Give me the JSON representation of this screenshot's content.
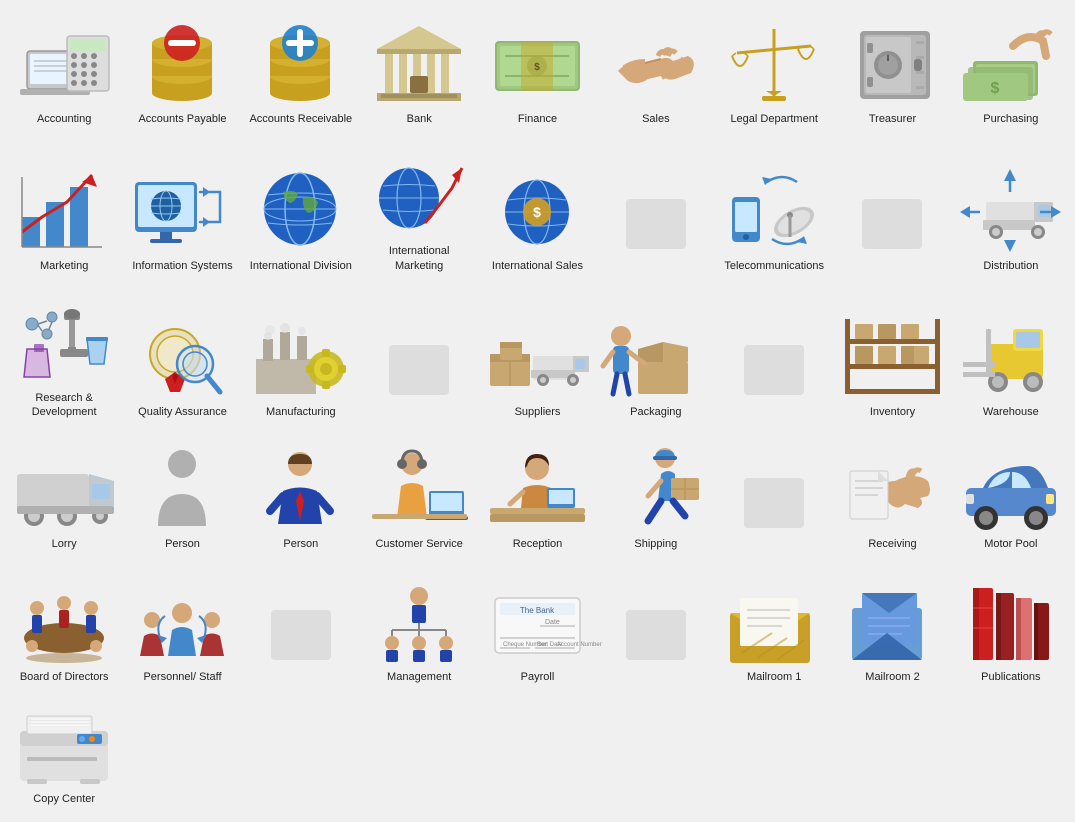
{
  "items": [
    {
      "id": "accounting",
      "label": "Accounting",
      "row": 1
    },
    {
      "id": "accounts-payable",
      "label": "Accounts Payable",
      "row": 1
    },
    {
      "id": "accounts-receivable",
      "label": "Accounts Receivable",
      "row": 1
    },
    {
      "id": "bank",
      "label": "Bank",
      "row": 1
    },
    {
      "id": "finance",
      "label": "Finance",
      "row": 1
    },
    {
      "id": "sales",
      "label": "Sales",
      "row": 1
    },
    {
      "id": "legal-department",
      "label": "Legal Department",
      "row": 1
    },
    {
      "id": "treasurer",
      "label": "Treasurer",
      "row": 1
    },
    {
      "id": "purchasing",
      "label": "Purchasing",
      "row": 1
    },
    {
      "id": "marketing",
      "label": "Marketing",
      "row": 2
    },
    {
      "id": "information-systems",
      "label": "Information Systems",
      "row": 2
    },
    {
      "id": "international-division",
      "label": "International Division",
      "row": 2
    },
    {
      "id": "international-marketing",
      "label": "International Marketing",
      "row": 2
    },
    {
      "id": "international-sales",
      "label": "International Sales",
      "row": 2
    },
    {
      "id": "blank2a",
      "label": "",
      "row": 2
    },
    {
      "id": "telecommunications",
      "label": "Telecommunications",
      "row": 2
    },
    {
      "id": "blank2b",
      "label": "",
      "row": 2
    },
    {
      "id": "distribution",
      "label": "Distribution",
      "row": 2
    },
    {
      "id": "research-development",
      "label": "Research & Development",
      "row": 3
    },
    {
      "id": "quality-assurance",
      "label": "Quality Assurance",
      "row": 3
    },
    {
      "id": "manufacturing",
      "label": "Manufacturing",
      "row": 3
    },
    {
      "id": "blank3a",
      "label": "",
      "row": 3
    },
    {
      "id": "suppliers",
      "label": "Suppliers",
      "row": 3
    },
    {
      "id": "packaging",
      "label": "Packaging",
      "row": 3
    },
    {
      "id": "blank3b",
      "label": "",
      "row": 3
    },
    {
      "id": "inventory",
      "label": "Inventory",
      "row": 3
    },
    {
      "id": "warehouse",
      "label": "Warehouse",
      "row": 3
    },
    {
      "id": "lorry",
      "label": "Lorry",
      "row": 4
    },
    {
      "id": "person1",
      "label": "Person",
      "row": 4
    },
    {
      "id": "person2",
      "label": "Person",
      "row": 4
    },
    {
      "id": "customer-service",
      "label": "Customer Service",
      "row": 4
    },
    {
      "id": "reception",
      "label": "Reception",
      "row": 4
    },
    {
      "id": "shipping",
      "label": "Shipping",
      "row": 4
    },
    {
      "id": "blank4a",
      "label": "",
      "row": 4
    },
    {
      "id": "receiving",
      "label": "Receiving",
      "row": 4
    },
    {
      "id": "motor-pool",
      "label": "Motor Pool",
      "row": 4
    },
    {
      "id": "board-of-directors",
      "label": "Board of Directors",
      "row": 5
    },
    {
      "id": "personnel-staff",
      "label": "Personnel/ Staff",
      "row": 5
    },
    {
      "id": "blank5a",
      "label": "",
      "row": 5
    },
    {
      "id": "management",
      "label": "Management",
      "row": 5
    },
    {
      "id": "payroll",
      "label": "Payroll",
      "row": 5
    },
    {
      "id": "blank5b",
      "label": "",
      "row": 5
    },
    {
      "id": "mailroom1",
      "label": "Mailroom 1",
      "row": 5
    },
    {
      "id": "mailroom2",
      "label": "Mailroom 2",
      "row": 5
    },
    {
      "id": "publications",
      "label": "Publications",
      "row": 5
    },
    {
      "id": "copy-center",
      "label": "Copy Center",
      "row": 5
    }
  ]
}
